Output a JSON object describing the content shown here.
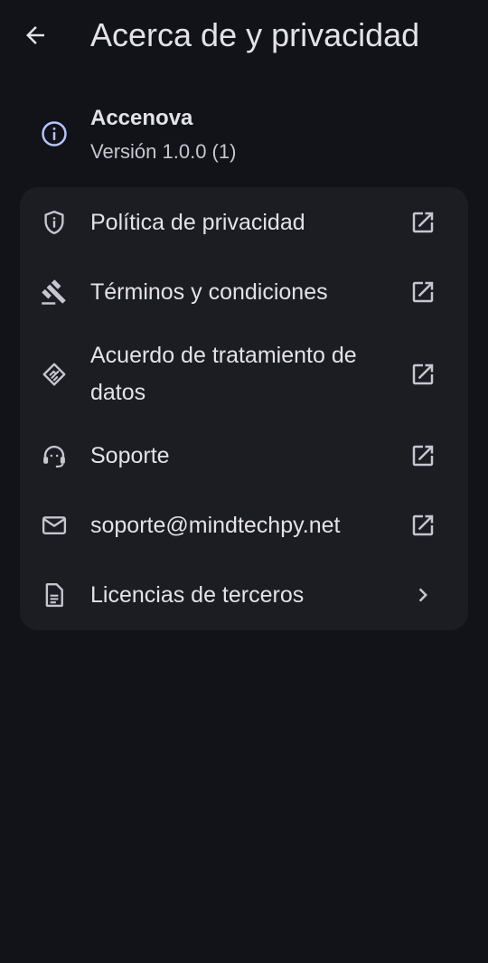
{
  "header": {
    "title": "Acerca de y privacidad",
    "back_icon": "arrow-back-icon"
  },
  "app_info": {
    "name": "Accenova",
    "version": "Versión 1.0.0 (1)",
    "icon": "info-icon"
  },
  "menu": {
    "items": [
      {
        "label": "Política de privacidad",
        "icon": "shield-icon",
        "trailing": "open-in-new-icon"
      },
      {
        "label": "Términos y condiciones",
        "icon": "gavel-icon",
        "trailing": "open-in-new-icon"
      },
      {
        "label": "Acuerdo de tratamiento de datos",
        "icon": "handshake-icon",
        "trailing": "open-in-new-icon"
      },
      {
        "label": "Soporte",
        "icon": "support-agent-icon",
        "trailing": "open-in-new-icon"
      },
      {
        "label": "soporte@mindtechpy.net",
        "icon": "mail-icon",
        "trailing": "open-in-new-icon"
      },
      {
        "label": "Licencias de terceros",
        "icon": "document-icon",
        "trailing": "chevron-right-icon"
      }
    ]
  },
  "colors": {
    "background": "#121318",
    "card": "#1c1d23",
    "text_primary": "#e3e2e9",
    "text_secondary": "#c5c6d0",
    "accent": "#b4c5ff"
  }
}
